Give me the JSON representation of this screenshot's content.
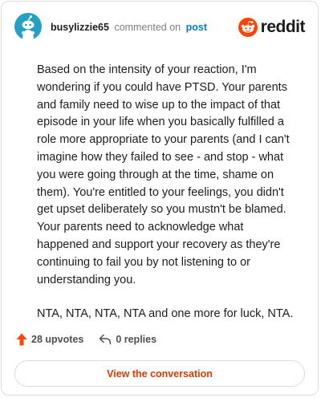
{
  "header": {
    "username": "busylizzie65",
    "action_text": "commented on",
    "post_link_text": "post",
    "brand_wordmark": "reddit",
    "avatar_icon": "snoo-avatar-icon",
    "brand_icon": "reddit-logo-icon"
  },
  "comment": {
    "paragraphs": [
      "Based on the intensity of your reaction, I'm wondering if you could have PTSD. Your parents and family need to wise up to the impact of that episode in your life when you basically fulfilled a role more appropriate to your parents (and I can't imagine how they failed to see - and stop - what you were going through at the time, shame on them). You're entitled to your feelings, you didn't get upset deliberately so you mustn't be blamed. Your parents need to acknowledge what happened and support your recovery as they're continuing to fail you by not listening to or understanding you.",
      "NTA, NTA, NTA, NTA and one more for luck, NTA."
    ]
  },
  "stats": {
    "upvotes": "28 upvotes",
    "replies": "0 replies",
    "upvote_icon": "upvote-arrow-icon",
    "reply_icon": "reply-arrow-icon"
  },
  "cta": {
    "label": "View the conversation"
  },
  "colors": {
    "accent_orange": "#ff4500",
    "cta_text": "#d93a00",
    "link_blue": "#0079d3",
    "avatar_teal": "#24a0c4",
    "border": "#dcdcdc"
  }
}
